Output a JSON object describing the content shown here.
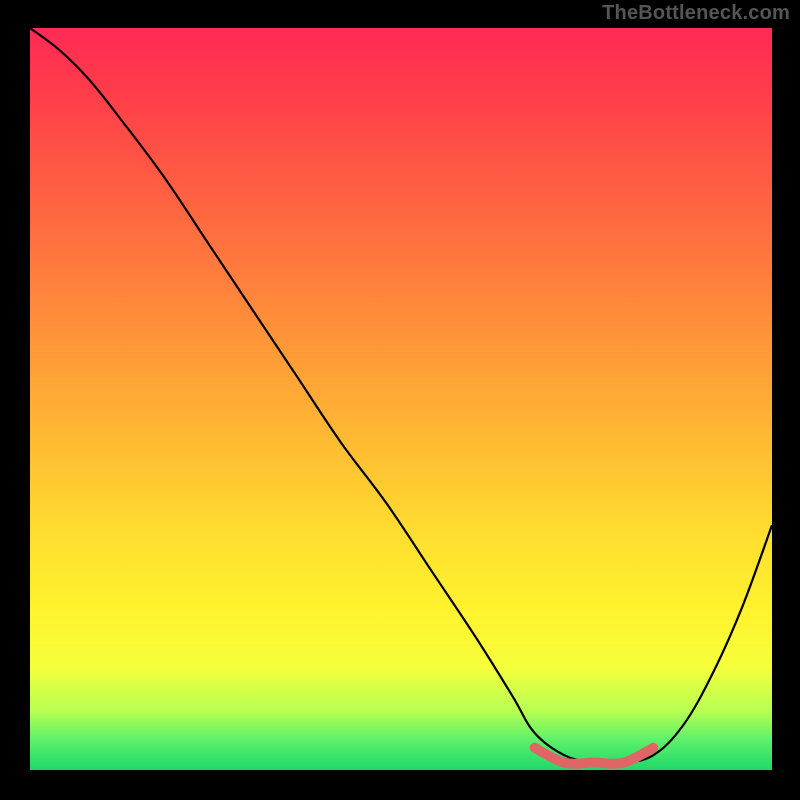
{
  "watermark": "TheBottleneck.com",
  "colors": {
    "background": "#000000",
    "curve": "#000000",
    "highlight": "#e06666",
    "gradient_top": "#ff2a55",
    "gradient_bottom": "#1fd86a"
  },
  "chart_data": {
    "type": "line",
    "title": "",
    "xlabel": "",
    "ylabel": "",
    "xlim": [
      0,
      100
    ],
    "ylim": [
      0,
      100
    ],
    "grid": false,
    "legend": false,
    "series": [
      {
        "name": "bottleneck-curve",
        "x": [
          0,
          4,
          8,
          12,
          18,
          24,
          30,
          36,
          42,
          48,
          54,
          60,
          65,
          68,
          72,
          76,
          80,
          84,
          88,
          92,
          96,
          100
        ],
        "y": [
          100,
          97,
          93,
          88,
          80,
          71,
          62,
          53,
          44,
          36,
          27,
          18,
          10,
          5,
          2,
          1,
          1,
          2,
          6,
          13,
          22,
          33
        ]
      },
      {
        "name": "optimal-range",
        "x": [
          68,
          72,
          76,
          80,
          84
        ],
        "y": [
          3,
          1,
          1,
          1,
          3
        ]
      }
    ],
    "annotations": []
  }
}
